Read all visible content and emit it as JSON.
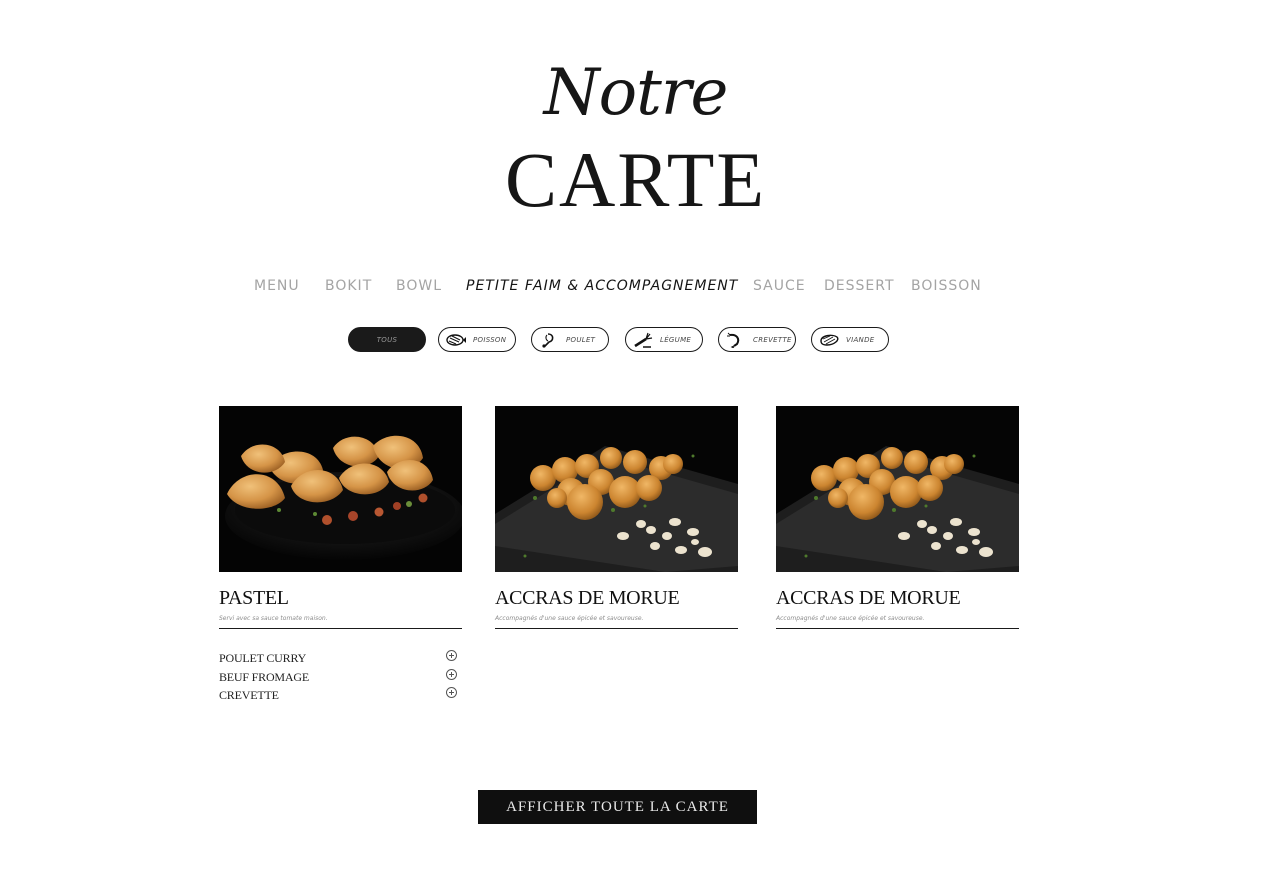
{
  "header": {
    "title_line1": "Notre",
    "title_line2": "CARTE"
  },
  "nav": {
    "items": [
      {
        "label": "MENU",
        "active": false
      },
      {
        "label": "BOKIT",
        "active": false
      },
      {
        "label": "BOWL",
        "active": false
      },
      {
        "label": "PETITE FAIM & ACCOMPAGNEMENT",
        "active": true
      },
      {
        "label": "SAUCE",
        "active": false
      },
      {
        "label": "DESSERT",
        "active": false
      },
      {
        "label": "BOISSON",
        "active": false
      }
    ]
  },
  "filters": {
    "items": [
      {
        "label": "TOUS",
        "icon": null,
        "active": true
      },
      {
        "label": "POISSON",
        "icon": "fish-icon",
        "active": false
      },
      {
        "label": "POULET",
        "icon": "chicken-leg-icon",
        "active": false
      },
      {
        "label": "LÉGUME",
        "icon": "vegetable-icon",
        "active": false
      },
      {
        "label": "CREVETTE",
        "icon": "shrimp-icon",
        "active": false
      },
      {
        "label": "VIANDE",
        "icon": "meat-icon",
        "active": false
      }
    ]
  },
  "cards": [
    {
      "name": "PASTEL",
      "description": "Servi avec sa sauce tomate maison.",
      "image": "pastel-photo",
      "options": [
        "POULET CURRY",
        "BEUF FROMAGE",
        "CREVETTE"
      ]
    },
    {
      "name": "ACCRAS DE MORUE",
      "description": "Accompagnés d'une sauce épicée et savoureuse.",
      "image": "accras-photo",
      "options": []
    },
    {
      "name": "ACCRAS DE MORUE",
      "description": "Accompagnés d'une sauce épicée et savoureuse.",
      "image": "accras-photo",
      "options": []
    }
  ],
  "cta": {
    "label": "AFFICHER TOUTE LA CARTE"
  }
}
